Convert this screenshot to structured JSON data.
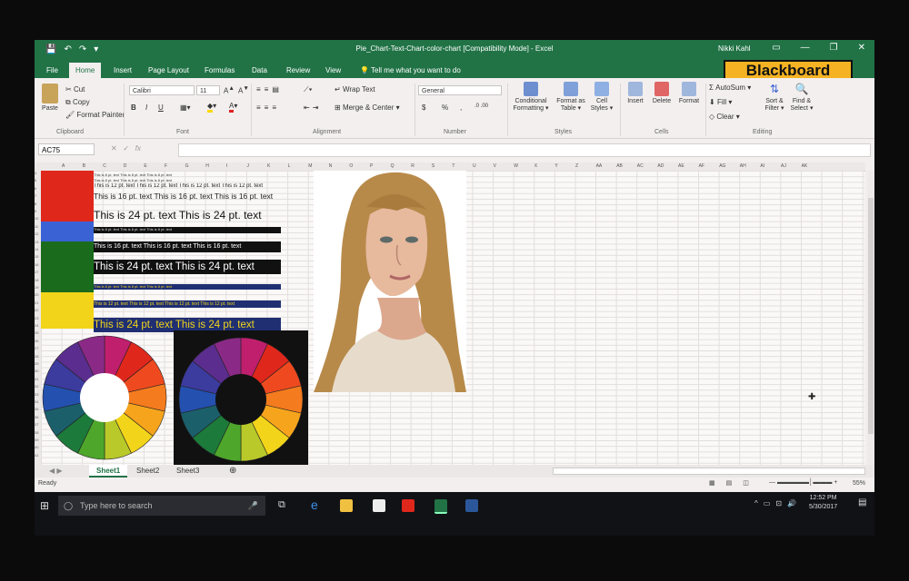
{
  "window": {
    "qat": [
      "💾",
      "↶",
      "↷",
      "▾"
    ],
    "title": "Pie_Chart-Text-Chart-color-chart  [Compatibility Mode]  -  Excel",
    "user": "Nikki Kahl",
    "controls": [
      "▭",
      "—",
      "❐",
      "✕"
    ]
  },
  "tabs": [
    "File",
    "Home",
    "Insert",
    "Page Layout",
    "Formulas",
    "Data",
    "Review",
    "View"
  ],
  "tell_me": "Tell me what you want to do",
  "logo": "Blackboard",
  "ribbon": {
    "clipboard": {
      "paste": "Paste",
      "cut": "Cut",
      "copy": "Copy",
      "format_painter": "Format Painter",
      "label": "Clipboard"
    },
    "font": {
      "name": "Calibri",
      "size": "11",
      "bold": "B",
      "italic": "I",
      "underline": "U",
      "label": "Font"
    },
    "alignment": {
      "wrap": "Wrap Text",
      "merge": "Merge & Center",
      "label": "Alignment"
    },
    "number": {
      "format": "General",
      "currency": "$",
      "percent": "%",
      "label": "Number"
    },
    "styles": {
      "conditional": [
        "Conditional",
        "Formatting"
      ],
      "format_table": [
        "Format as",
        "Table"
      ],
      "cell_styles": [
        "Cell",
        "Styles"
      ],
      "label": "Styles"
    },
    "cells": {
      "insert": "Insert",
      "delete": "Delete",
      "format": "Format",
      "label": "Cells"
    },
    "editing": {
      "autosum": "AutoSum",
      "fill": "Fill",
      "clear": "Clear",
      "sort": [
        "Sort &",
        "Filter"
      ],
      "find": [
        "Find &",
        "Select"
      ],
      "label": "Editing"
    }
  },
  "formula_bar": {
    "name_box": "AC75",
    "cancel": "✕",
    "enter": "✓",
    "fx": "fx"
  },
  "columns": [
    "A",
    "B",
    "C",
    "D",
    "E",
    "F",
    "G",
    "H",
    "I",
    "J",
    "K",
    "L",
    "M",
    "N",
    "O",
    "P",
    "Q",
    "R",
    "S",
    "T",
    "U",
    "V",
    "W",
    "X",
    "Y",
    "Z",
    "AA",
    "AB",
    "AC",
    "AD",
    "AE",
    "AF",
    "AG",
    "AH",
    "AI",
    "AJ",
    "AK"
  ],
  "rows": [
    "4",
    "5",
    "6",
    "7",
    "8",
    "9",
    "10",
    "11",
    "12",
    "13",
    "14",
    "15",
    "16",
    "17",
    "18",
    "19",
    "20",
    "21",
    "22",
    "23",
    "24",
    "25",
    "26",
    "27",
    "28",
    "29",
    "30",
    "31",
    "32",
    "33",
    "34",
    "35",
    "36",
    "37",
    "38",
    "39",
    "40",
    "41"
  ],
  "sheet_text": {
    "t8": "This is 8 pt. text  This is 8 pt. text  This is 8 pt. text",
    "t8b": "This is 8 pt. text  This is 8 pt. text  This is 8 pt. text",
    "t12": "This is 12 pt. text   This is 12 pt. text   This is 12 pt. text   This is 12 pt. text",
    "t16": "This is 16 pt. text   This is 16 pt. text   This is 16 pt. text",
    "t24": "This is 24 pt. text   This is 24 pt. text"
  },
  "colors": {
    "red": "#e0271c",
    "blue": "#3a62d4",
    "green": "#1a6b1c",
    "yellow": "#f2d41a",
    "navy": "#1f2f72",
    "black": "#111111",
    "excel_green": "#217346"
  },
  "sheets": [
    "Sheet1",
    "Sheet2",
    "Sheet3"
  ],
  "status": {
    "ready": "Ready",
    "zoom": "55%"
  },
  "taskbar": {
    "search_placeholder": "Type here to search",
    "time": "12:52 PM",
    "date": "5/30/2017"
  }
}
